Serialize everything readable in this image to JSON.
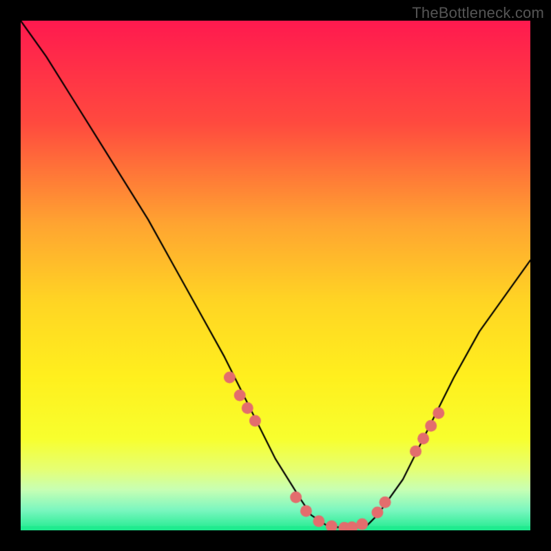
{
  "watermark": "TheBottleneck.com",
  "chart_data": {
    "type": "line",
    "title": "",
    "xlabel": "",
    "ylabel": "",
    "x_range": [
      0,
      100
    ],
    "y_range": [
      0,
      100
    ],
    "background_gradient": {
      "stops": [
        {
          "pos": 0.0,
          "color": "#ff1a4f"
        },
        {
          "pos": 0.2,
          "color": "#ff4a3f"
        },
        {
          "pos": 0.4,
          "color": "#ffa531"
        },
        {
          "pos": 0.55,
          "color": "#ffd524"
        },
        {
          "pos": 0.7,
          "color": "#fff01e"
        },
        {
          "pos": 0.82,
          "color": "#f8ff2e"
        },
        {
          "pos": 0.88,
          "color": "#e6ff74"
        },
        {
          "pos": 0.92,
          "color": "#c8ffb4"
        },
        {
          "pos": 0.96,
          "color": "#7cf7c0"
        },
        {
          "pos": 1.0,
          "color": "#1feb8f"
        }
      ]
    },
    "curve": {
      "x": [
        0,
        5,
        10,
        15,
        20,
        25,
        30,
        35,
        40,
        45,
        50,
        55,
        57,
        60,
        63,
        65,
        68,
        70,
        75,
        80,
        85,
        90,
        95,
        100
      ],
      "y": [
        100,
        93,
        85,
        77,
        69,
        61,
        52,
        43,
        34,
        24,
        14,
        6,
        3,
        1,
        0.5,
        0.5,
        1,
        3,
        10,
        20,
        30,
        39,
        46,
        53
      ]
    },
    "marker_color": "#e36d6d",
    "markers": [
      {
        "x": 41.0,
        "y": 30.0
      },
      {
        "x": 43.0,
        "y": 26.5
      },
      {
        "x": 44.5,
        "y": 24.0
      },
      {
        "x": 46.0,
        "y": 21.5
      },
      {
        "x": 54.0,
        "y": 6.5
      },
      {
        "x": 56.0,
        "y": 3.8
      },
      {
        "x": 58.5,
        "y": 1.8
      },
      {
        "x": 61.0,
        "y": 0.8
      },
      {
        "x": 63.5,
        "y": 0.5
      },
      {
        "x": 65.0,
        "y": 0.6
      },
      {
        "x": 67.0,
        "y": 1.2
      },
      {
        "x": 70.0,
        "y": 3.5
      },
      {
        "x": 71.5,
        "y": 5.5
      },
      {
        "x": 77.5,
        "y": 15.5
      },
      {
        "x": 79.0,
        "y": 18.0
      },
      {
        "x": 80.5,
        "y": 20.5
      },
      {
        "x": 82.0,
        "y": 23.0
      }
    ]
  }
}
